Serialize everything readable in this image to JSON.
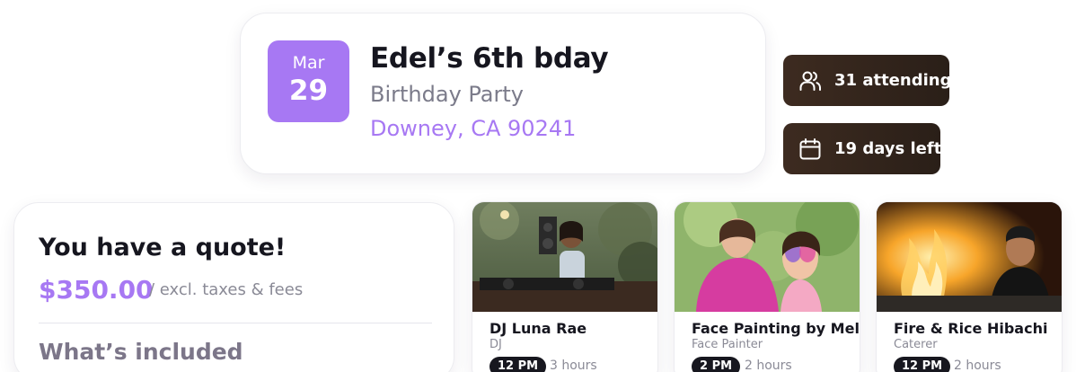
{
  "event": {
    "month": "Mar",
    "day": "29",
    "title": "Edel’s 6th bday",
    "type": "Birthday Party",
    "location": "Downey, CA 90241"
  },
  "stats": {
    "attending": "31 attending",
    "days_left": "19 days left"
  },
  "quote": {
    "heading": "You have a quote!",
    "price": "$350.00",
    "note": "/ excl. taxes & fees",
    "included_heading": "What’s included"
  },
  "vendors": [
    {
      "name": "DJ Luna Rae",
      "category": "DJ",
      "time": "12 PM",
      "duration": "3 hours"
    },
    {
      "name": "Face Painting by Mel",
      "category": "Face Painter",
      "time": "2 PM",
      "duration": "2 hours"
    },
    {
      "name": "Fire & Rice Hibachi",
      "category": "Caterer",
      "time": "12 PM",
      "duration": "2 hours"
    }
  ],
  "colors": {
    "accent": "#a778f3",
    "pill_bg": "#2f221a",
    "time_chip": "#17171f"
  },
  "icons": {
    "attending": "people-icon",
    "days_left": "calendar-icon"
  }
}
